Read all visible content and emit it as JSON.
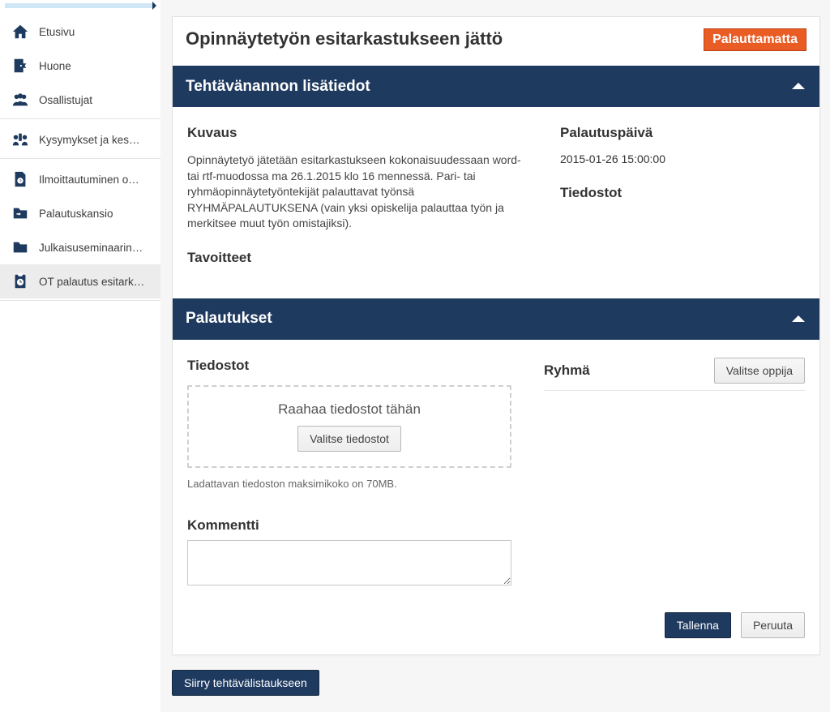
{
  "sidebar": {
    "items": [
      {
        "label": "Etusivu",
        "icon": "home-icon"
      },
      {
        "label": "Huone",
        "icon": "door-icon"
      },
      {
        "label": "Osallistujat",
        "icon": "people-icon"
      }
    ],
    "items2": [
      {
        "label": "Kysymykset ja kes…",
        "icon": "qa-icon"
      }
    ],
    "items3": [
      {
        "label": "Ilmoittautuminen o…",
        "icon": "file-info-icon"
      },
      {
        "label": "Palautuskansio",
        "icon": "folder-back-icon"
      },
      {
        "label": "Julkaisuseminaarin…",
        "icon": "folder-icon"
      },
      {
        "label": "OT palautus esitark…",
        "icon": "clipboard-clock-icon",
        "active": true
      }
    ]
  },
  "header": {
    "title": "Opinnäytetyön esitarkastukseen jättö",
    "status": "Palauttamatta"
  },
  "assignment": {
    "section_title": "Tehtävänannon lisätiedot",
    "description_label": "Kuvaus",
    "description_text": "Opinnäytetyö jätetään esitarkastukseen kokonaisuudessaan word- tai rtf-muodossa ma 26.1.2015 klo 16 mennessä. Pari- tai ryhmäopinnäytetyöntekijät palauttavat työnsä RYHMÄPALAUTUKSENA (vain yksi opiskelija palauttaa työn ja merkitsee muut työn omistajiksi).",
    "goals_label": "Tavoitteet",
    "return_date_label": "Palautuspäivä",
    "return_date_value": "2015-01-26 15:00:00",
    "files_label": "Tiedostot"
  },
  "submissions": {
    "section_title": "Palautukset",
    "files_label": "Tiedostot",
    "group_label": "Ryhmä",
    "choose_student_label": "Valitse oppija",
    "dropzone_title": "Raahaa tiedostot tähän",
    "choose_files_label": "Valitse tiedostot",
    "size_hint": "Ladattavan tiedoston maksimikoko on 70MB.",
    "comment_label": "Kommentti",
    "save_label": "Tallenna",
    "cancel_label": "Peruuta"
  },
  "footer": {
    "back_label": "Siirry tehtävälistaukseen"
  }
}
